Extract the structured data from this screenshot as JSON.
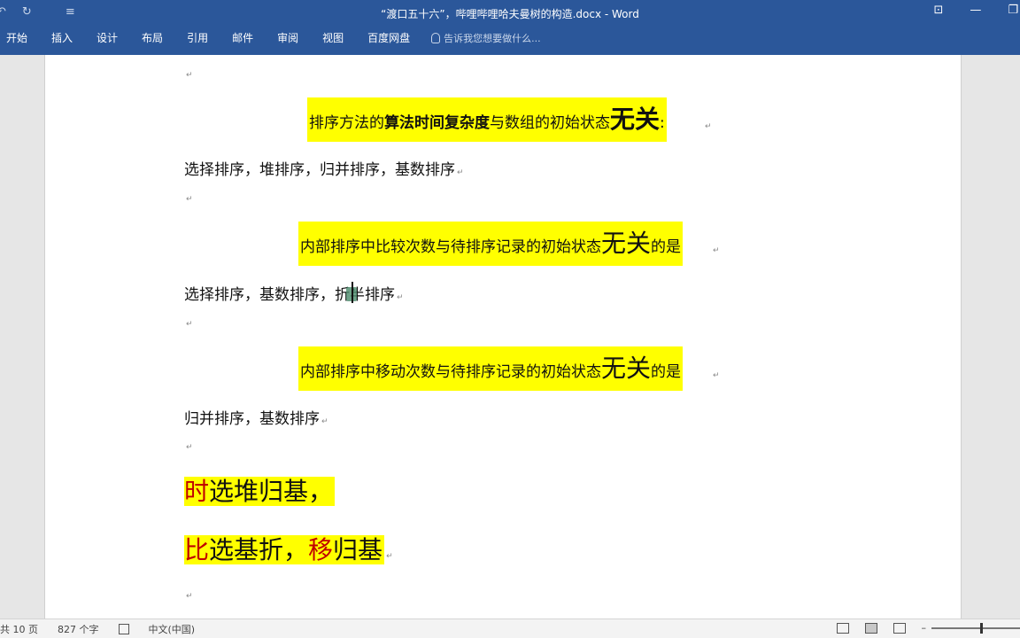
{
  "titlebar": {
    "undo_icon": "undo-icon",
    "redo_icon": "redo-icon",
    "customize_icon": "customize-qat-icon",
    "doc_title": "“渡口五十六”，哔哩哔哩哈夫曼树的构造.docx - Word"
  },
  "ribbon": {
    "tabs": [
      "开始",
      "插入",
      "设计",
      "布局",
      "引用",
      "邮件",
      "审阅",
      "视图",
      "百度网盘"
    ],
    "tell_me": "告诉我您想要做什么..."
  },
  "document": {
    "heading1": {
      "prefix": "排序方法的",
      "bold": "算法时间复杂度",
      "mid": "与数组的初始状态",
      "big": "无关",
      "suffix": ":"
    },
    "para1": "选择排序，堆排序，归并排序，基数排序",
    "heading2": {
      "text": "内部排序中比较次数与待排序记录的初始状态",
      "big": "无关",
      "suffix": "的是"
    },
    "para2": "选择排序，基数排序，折半排序",
    "heading3": {
      "text": "内部排序中移动次数与待排序记录的初始状态",
      "big": "无关",
      "suffix": "的是"
    },
    "para3": "归并排序，基数排序",
    "mnemonic1": {
      "red": "时",
      "rest": "选堆归基，"
    },
    "mnemonic2": {
      "red1": "比",
      "rest1": "选基折，",
      "red2": "移",
      "rest2": "归基"
    },
    "para_mark": "↵"
  },
  "statusbar": {
    "pages": "共 10 页",
    "words": "827 个字",
    "language": "中文(中国)"
  },
  "colors": {
    "ribbon_blue": "#2b579a",
    "highlight": "#ffff00",
    "red_text": "#c00000"
  }
}
